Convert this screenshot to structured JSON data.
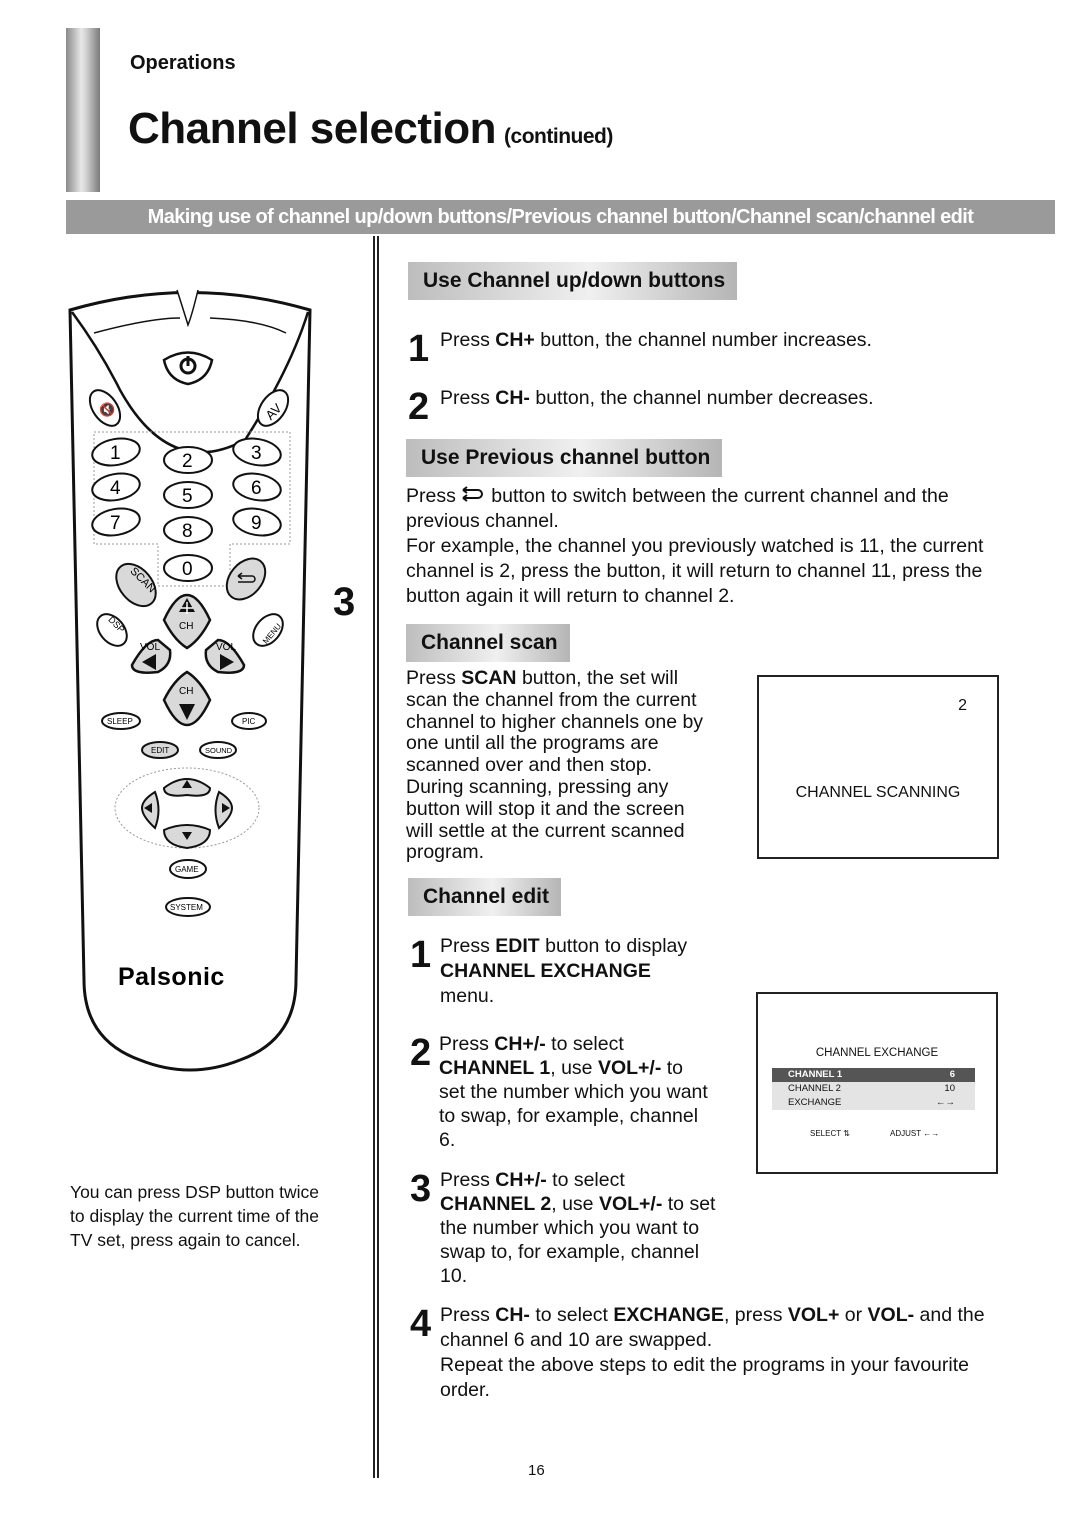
{
  "header": {
    "section": "Operations",
    "title": "Channel selection",
    "title_suffix": "(continued)",
    "banner": "Making use of channel up/down buttons/Previous channel button/Channel scan/channel edit"
  },
  "figure_number": "3",
  "remote": {
    "brand": "Palsonic",
    "buttons": {
      "power": "power-icon",
      "mute": "mute-icon",
      "av": "AV",
      "digits": [
        "1",
        "2",
        "3",
        "4",
        "5",
        "6",
        "7",
        "8",
        "9",
        "0"
      ],
      "scan": "SCAN",
      "recall": "recall-icon",
      "dsp": "DSP",
      "menu": "MENU",
      "ch": "CH",
      "vol": "VOL",
      "sleep": "SLEEP",
      "pic": "PIC",
      "edit": "EDIT",
      "sound": "SOUND",
      "game": "GAME",
      "system": "SYSTEM"
    },
    "note": "You can press DSP button twice to display the current time of the TV set, press again to cancel."
  },
  "sections": {
    "updown": {
      "heading": "Use Channel up/down buttons",
      "steps": [
        {
          "num": "1",
          "pre": "Press ",
          "bold": "CH+",
          "post": " button, the channel number increases."
        },
        {
          "num": "2",
          "pre": "Press ",
          "bold": "CH-",
          "post": " button, the channel number decreases."
        }
      ]
    },
    "previous": {
      "heading": "Use Previous channel button",
      "line1_pre": "Press",
      "line1_post": " button to switch between the current channel and the previous channel.",
      "line2": "For example, the channel you previously watched is 11, the current channel is 2, press the button, it will return to channel 11, press the button again it will return to channel 2."
    },
    "scan": {
      "heading": "Channel scan",
      "pre": "Press ",
      "bold": "SCAN",
      "post": " button, the set will scan the channel from the current channel to higher channels one by one until all the programs are scanned over and then stop. During scanning, pressing any button will stop it and the screen will settle at the current scanned program.",
      "osd": {
        "channel": "2",
        "message": "CHANNEL SCANNING"
      }
    },
    "edit": {
      "heading": "Channel edit",
      "step1": {
        "num": "1",
        "pre": "Press ",
        "b1": "EDIT",
        "mid": " button to display ",
        "b2": "CHANNEL EXCHANGE",
        "post": " menu."
      },
      "step2": {
        "num": "2",
        "pre": "Press ",
        "b1": "CH+/-",
        "mid1": " to select ",
        "b2": "CHANNEL 1",
        "mid2": ", use ",
        "b3": "VOL+/-",
        "post": " to set the number which you want to swap, for example, channel 6."
      },
      "step3": {
        "num": "3",
        "pre": "Press ",
        "b1": "CH+/-",
        "mid1": " to select ",
        "b2": "CHANNEL 2",
        "mid2": ", use ",
        "b3": "VOL+/-",
        "post": " to set the number which you want to swap to, for example, channel 10."
      },
      "step4": {
        "num": "4",
        "pre": "Press ",
        "b1": "CH-",
        "mid1": " to select ",
        "b2": "EXCHANGE",
        "mid2": ", press ",
        "b3": "VOL+",
        "mid3": " or ",
        "b4": "VOL-",
        "post": " and the channel 6 and 10 are swapped."
      },
      "repeat": "Repeat the above steps to edit the programs in your favourite order.",
      "osd": {
        "title": "CHANNEL EXCHANGE",
        "rows": [
          {
            "label": "CHANNEL 1",
            "value": "6",
            "selected": true
          },
          {
            "label": "CHANNEL 2",
            "value": "10",
            "selected": false
          },
          {
            "label": "EXCHANGE",
            "value": "←→",
            "selected": false
          }
        ],
        "select_hint": "SELECT",
        "adjust_hint": "ADJUST"
      }
    }
  },
  "colors": {
    "banner_bg": "#9a9a9a",
    "osd_highlight": "#555555",
    "osd_row_bg": "#e4e4e4",
    "remote_gray_button": "#d9d9d9"
  },
  "footer": {
    "page_number": "16"
  }
}
